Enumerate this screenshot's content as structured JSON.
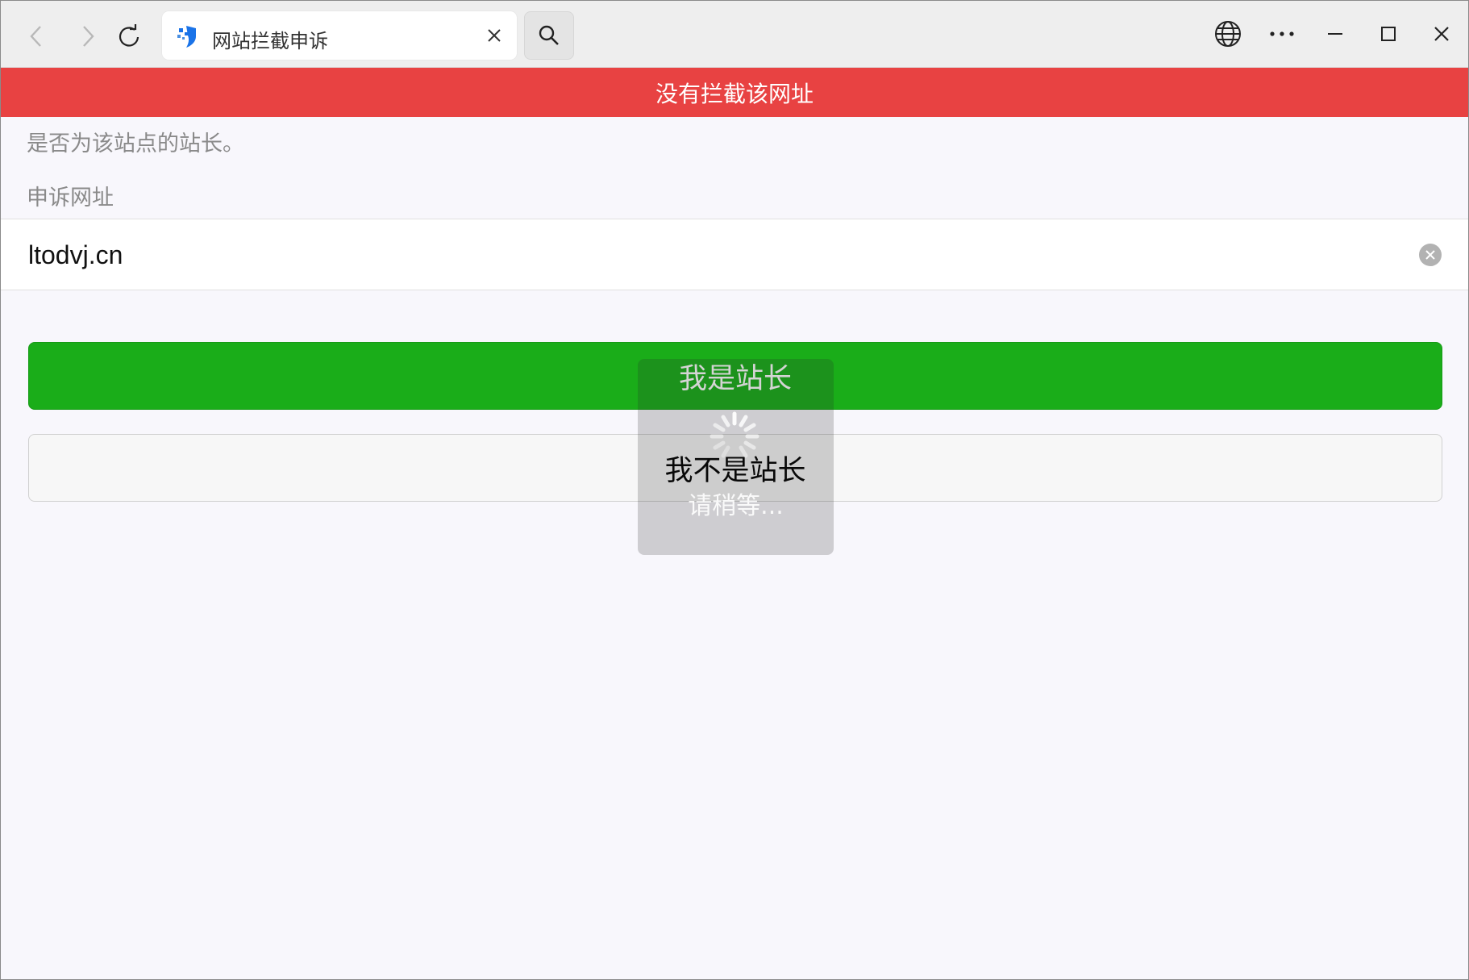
{
  "browser": {
    "tab": {
      "title": "网站拦截申诉",
      "favicon": "shield-face-icon"
    },
    "icons": {
      "back": "chevron-left-icon",
      "forward": "chevron-right-icon",
      "reload": "reload-icon",
      "search": "search-icon",
      "globe": "globe-icon",
      "more": "more-horizontal-icon",
      "minimize": "minimize-icon",
      "maximize": "maximize-icon",
      "close": "close-icon"
    }
  },
  "page": {
    "banner": "没有拦截该网址",
    "question": "是否为该站点的站长。",
    "url_label": "申诉网址",
    "url_value": "ltodvj.cn",
    "primary_button": "我是站长",
    "secondary_button": "我不是站长",
    "toast_text": "请稍等..."
  },
  "colors": {
    "banner": "#e84242",
    "primary": "#1aad19",
    "background": "#f8f7fc"
  }
}
